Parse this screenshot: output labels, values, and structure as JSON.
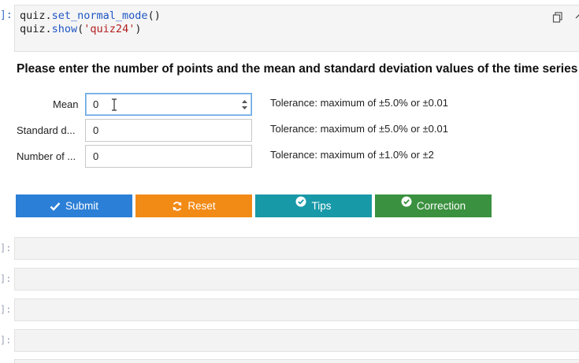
{
  "code_cell": {
    "prompt": "]:",
    "line1": {
      "obj": "quiz.",
      "fn": "set_normal_mode",
      "rest": "()"
    },
    "line2": {
      "obj": "quiz.",
      "fn": "show",
      "open": "(",
      "arg": "'quiz24'",
      "close": ")"
    },
    "copy_icon": "copy-icon",
    "collapse_icon": "chevron-up-icon"
  },
  "quiz": {
    "heading": "Please enter the number of points and the mean and standard deviation values of the time series",
    "fields": [
      {
        "label": "Mean",
        "value": "0",
        "tolerance": "Tolerance: maximum of ±5.0% or ±0.01"
      },
      {
        "label": "Standard d...",
        "value": "0",
        "tolerance": "Tolerance: maximum of ±5.0% or ±0.01"
      },
      {
        "label": "Number of ...",
        "value": "0",
        "tolerance": "Tolerance: maximum of ±1.0% or ±2"
      }
    ],
    "buttons": {
      "submit": "Submit",
      "reset": "Reset",
      "tips": "Tips",
      "correction": "Correction"
    },
    "colors": {
      "submit": "#2b7fd6",
      "reset": "#f28a16",
      "tips": "#1899a8",
      "correction": "#3a913f"
    }
  },
  "empty_cells": {
    "prompt": "]:"
  }
}
